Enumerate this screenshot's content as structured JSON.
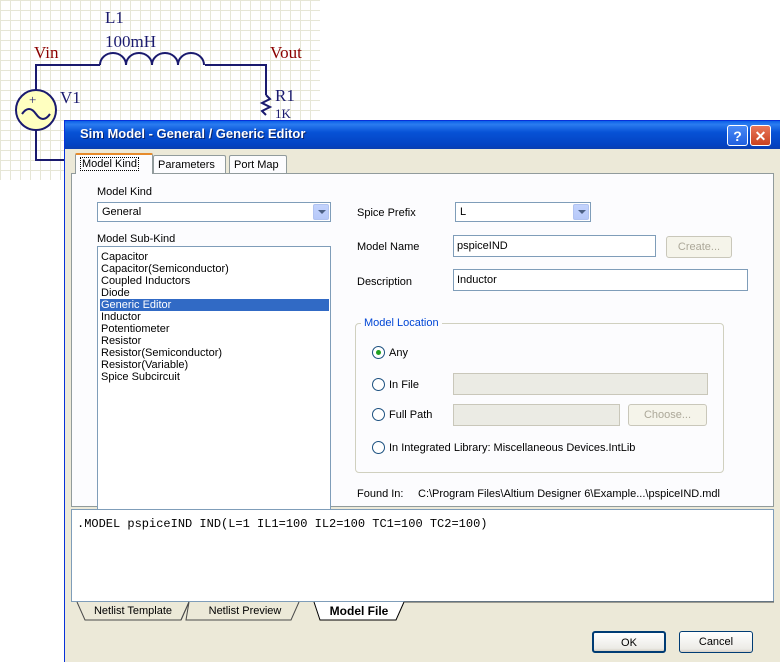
{
  "schematic": {
    "inductor_ref": "L1",
    "inductor_value": "100mH",
    "net_in": "Vin",
    "net_out": "Vout",
    "source_ref": "V1",
    "resistor_ref": "R1",
    "resistor_value": "1K",
    "source_plus": "+"
  },
  "dialog": {
    "title": "Sim Model - General / Generic Editor",
    "help_label": "?",
    "close_label": "✕"
  },
  "tabs": [
    {
      "label": "Model Kind",
      "active": true
    },
    {
      "label": "Parameters",
      "active": false
    },
    {
      "label": "Port Map",
      "active": false
    }
  ],
  "model_kind": {
    "label": "Model Kind",
    "value": "General"
  },
  "model_sub_kind": {
    "label": "Model Sub-Kind",
    "items": [
      "Capacitor",
      "Capacitor(Semiconductor)",
      "Coupled Inductors",
      "Diode",
      "Generic Editor",
      "Inductor",
      "Potentiometer",
      "Resistor",
      "Resistor(Semiconductor)",
      "Resistor(Variable)",
      "Spice Subcircuit"
    ],
    "selected": "Generic Editor"
  },
  "spice_prefix": {
    "label": "Spice Prefix",
    "value": "L"
  },
  "model_name": {
    "label": "Model Name",
    "value": "pspiceIND",
    "create_label": "Create..."
  },
  "description": {
    "label": "Description",
    "value": "Inductor"
  },
  "model_location": {
    "title": "Model Location",
    "options": [
      {
        "label": "Any",
        "checked": true
      },
      {
        "label": "In File",
        "checked": false
      },
      {
        "label": "Full Path",
        "checked": false
      },
      {
        "label": "In Integrated Library: Miscellaneous Devices.IntLib",
        "checked": false
      }
    ],
    "choose_label": "Choose..."
  },
  "found_in": {
    "label": "Found In:",
    "value": "C:\\Program Files\\Altium Designer 6\\Example...\\pspiceIND.mdl"
  },
  "netlist": {
    "code": ".MODEL pspiceIND IND(L=1 IL1=100 IL2=100 TC1=100 TC2=100)",
    "tabs": [
      {
        "label": "Netlist Template",
        "active": false
      },
      {
        "label": "Netlist Preview",
        "active": false
      },
      {
        "label": "Model File",
        "active": true
      }
    ]
  },
  "buttons": {
    "ok": "OK",
    "cancel": "Cancel"
  },
  "colors": {
    "titlebar": "#0752d6",
    "selection": "#316ac5",
    "dialog_bg": "#ece9d8",
    "group_title": "#0046d5"
  }
}
